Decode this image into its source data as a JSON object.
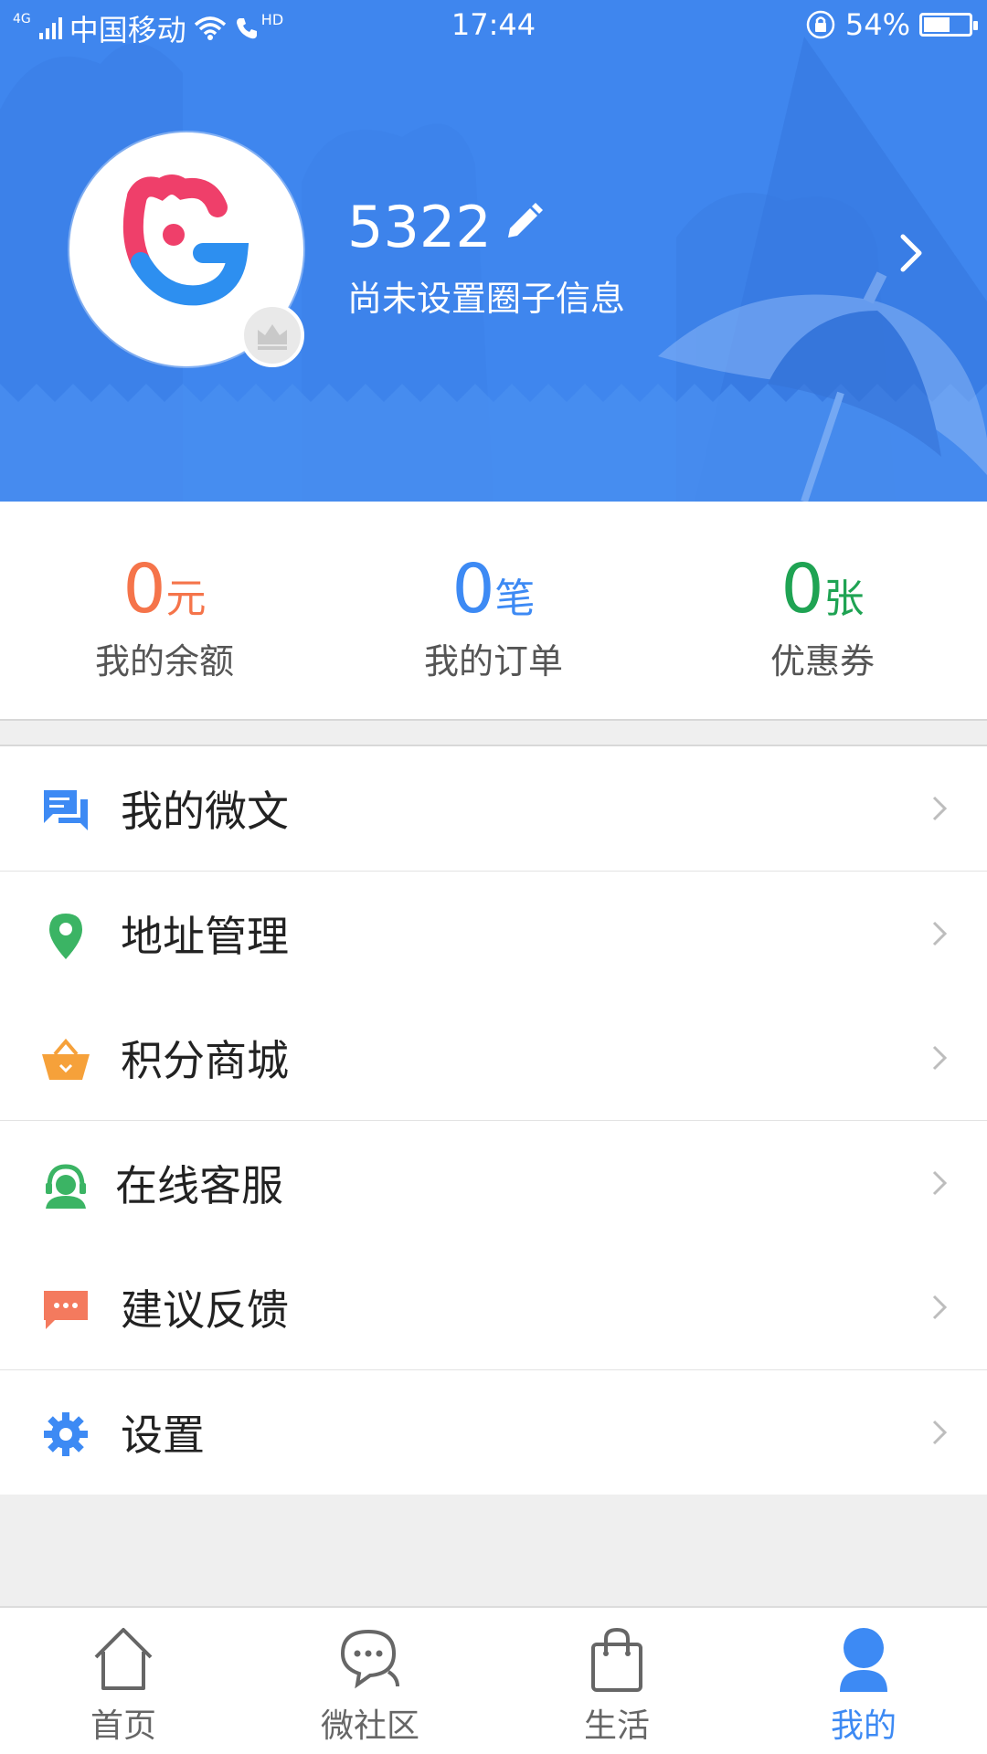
{
  "status_bar": {
    "network": "4G",
    "carrier": "中国移动",
    "hd": "HD",
    "time": "17:44",
    "battery_percent": "54%",
    "battery_level": 0.54
  },
  "profile": {
    "username": "5322",
    "subtitle": "尚未设置圈子信息",
    "icons": [
      "avatar-logo",
      "crown-icon",
      "edit-icon",
      "chevron-right-icon"
    ]
  },
  "stats": [
    {
      "value": "0",
      "unit": "元",
      "label": "我的余额",
      "color": "#f5744a"
    },
    {
      "value": "0",
      "unit": "笔",
      "label": "我的订单",
      "color": "#3d8af4"
    },
    {
      "value": "0",
      "unit": "张",
      "label": "优惠券",
      "color": "#1fa353"
    }
  ],
  "menu": [
    {
      "label": "我的微文",
      "icon": "chat-bubbles-icon",
      "color": "#3d8af4"
    },
    {
      "label": "地址管理",
      "icon": "location-pin-icon",
      "color": "#3bb464"
    },
    {
      "label": "积分商城",
      "icon": "basket-icon",
      "color": "#f6a13a"
    },
    {
      "label": "在线客服",
      "icon": "headset-icon",
      "color": "#3bb464"
    },
    {
      "label": "建议反馈",
      "icon": "feedback-icon",
      "color": "#f47a5e"
    },
    {
      "label": "设置",
      "icon": "gear-icon",
      "color": "#3d8af4"
    }
  ],
  "bottom_nav": [
    {
      "label": "首页",
      "icon": "home-icon",
      "active": false
    },
    {
      "label": "微社区",
      "icon": "community-icon",
      "active": false
    },
    {
      "label": "生活",
      "icon": "shopping-bag-icon",
      "active": false
    },
    {
      "label": "我的",
      "icon": "user-icon",
      "active": true
    }
  ],
  "colors": {
    "header_blue": "#3f86ee",
    "active_blue": "#3d8af4"
  }
}
